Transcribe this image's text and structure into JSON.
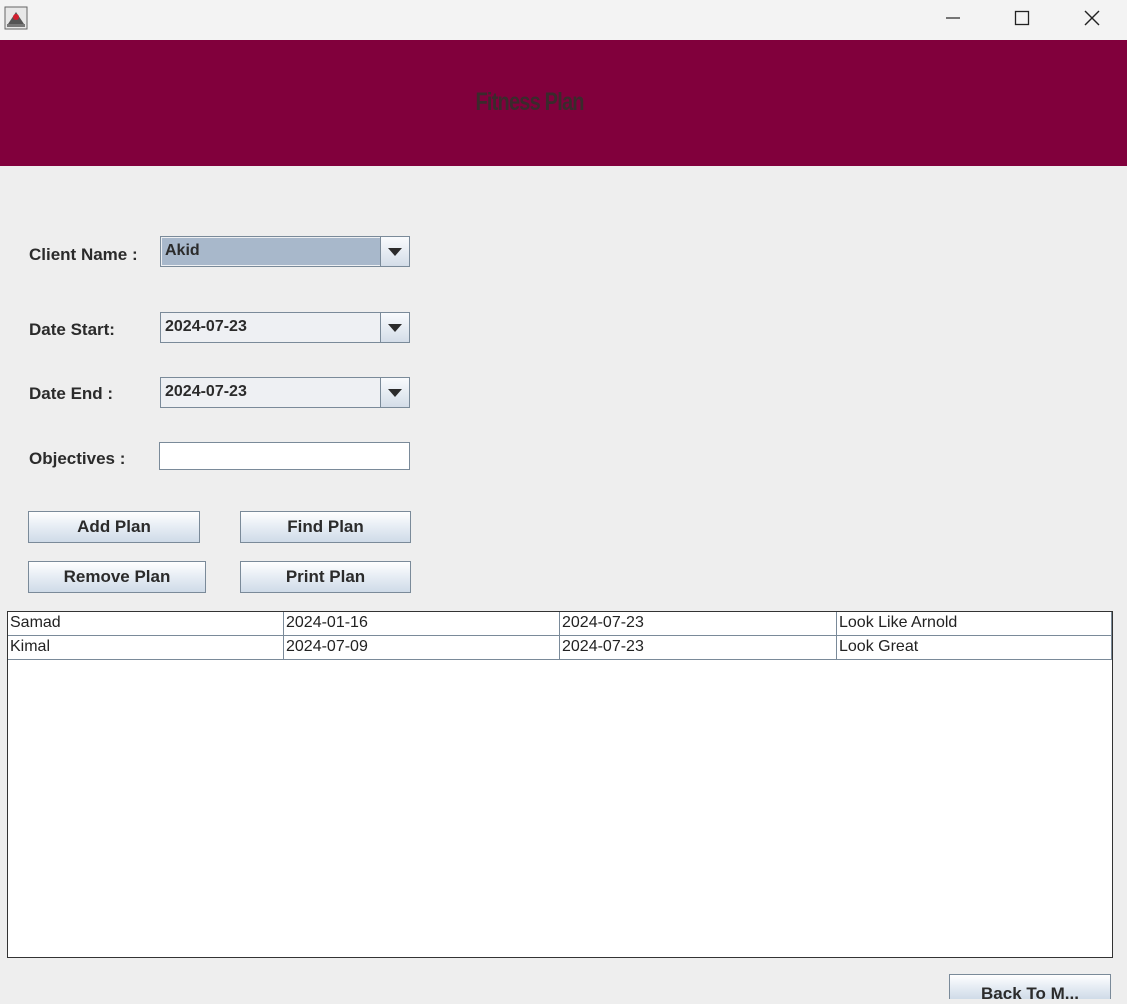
{
  "window": {
    "minimize_icon": "minimize-icon",
    "maximize_icon": "maximize-icon",
    "close_icon": "close-icon",
    "app_icon": "java-app-icon"
  },
  "header": {
    "title": "Fitness Plan",
    "background": "#81003c"
  },
  "form": {
    "client_label": "Client Name :",
    "client_value": "Akid",
    "date_start_label": "Date Start:",
    "date_start_value": "2024-07-23",
    "date_end_label": "Date End :",
    "date_end_value": "2024-07-23",
    "objectives_label": "Objectives :",
    "objectives_value": ""
  },
  "buttons": {
    "add": "Add Plan",
    "find": "Find Plan",
    "remove": "Remove Plan",
    "print": "Print Plan",
    "back": "Back To M..."
  },
  "table": {
    "rows": [
      [
        "Samad",
        "2024-01-16",
        "2024-07-23",
        "Look Like Arnold"
      ],
      [
        "Kimal",
        "2024-07-09",
        "2024-07-23",
        "Look Great"
      ]
    ]
  }
}
